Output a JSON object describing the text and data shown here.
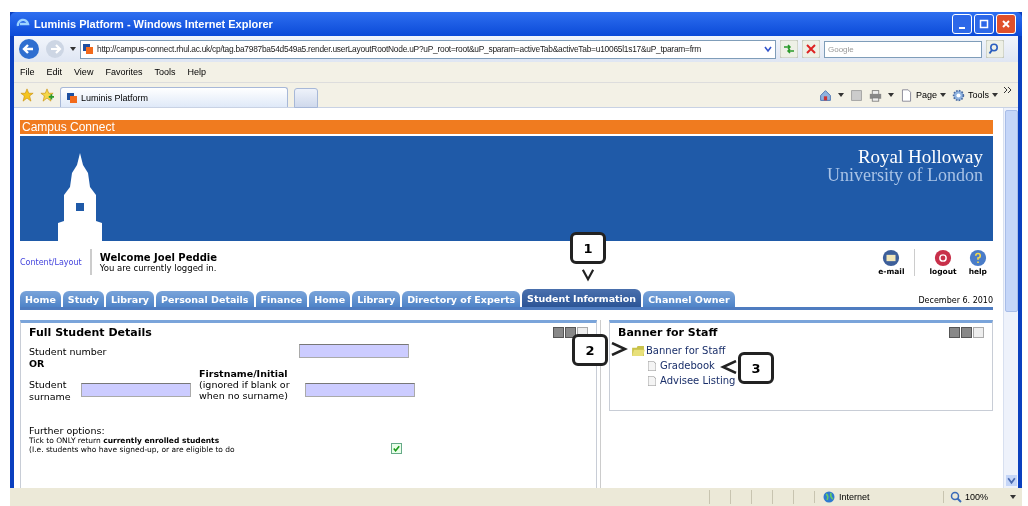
{
  "window": {
    "title": "Luminis Platform - Windows Internet Explorer"
  },
  "address_bar": {
    "url": "http://campus-connect.rhul.ac.uk/cp/tag.ba7987ba54d549a5.render.userLayoutRootNode.uP?uP_root=root&uP_sparam=activeTab&activeTab=u10065l1s17&uP_tparam=frm"
  },
  "search": {
    "placeholder": "Google"
  },
  "menu": [
    "File",
    "Edit",
    "View",
    "Favorites",
    "Tools",
    "Help"
  ],
  "browser_tab": {
    "title": "Luminis Platform"
  },
  "command_bar": [
    "Page",
    "Tools"
  ],
  "page": {
    "header": "Campus Connect",
    "institution": [
      "Royal Holloway",
      "University of London"
    ],
    "content_layout_link": "Content/Layout",
    "welcome": "Welcome Joel Peddie",
    "login_status": "You are currently logged in.",
    "actions": [
      {
        "kind": "email",
        "label": "e-mail"
      },
      {
        "kind": "logout",
        "label": "logout"
      },
      {
        "kind": "help",
        "label": "help"
      }
    ],
    "tabs": [
      {
        "label": "Home",
        "selected": false
      },
      {
        "label": "Study",
        "selected": false
      },
      {
        "label": "Library",
        "selected": false
      },
      {
        "label": "Personal Details",
        "selected": false
      },
      {
        "label": "Finance",
        "selected": false
      },
      {
        "label": "Home",
        "selected": false
      },
      {
        "label": "Library",
        "selected": false
      },
      {
        "label": "Directory of Experts",
        "selected": false
      },
      {
        "label": "Student Information",
        "selected": true
      },
      {
        "label": "Channel Owner",
        "selected": false
      }
    ],
    "date": "December 6. 2010"
  },
  "student_panel": {
    "title": "Full Student Details",
    "student_number_label": "Student number",
    "or_label": "OR",
    "surname_label": "Student surname",
    "firstname_label": "Firstname/Initial",
    "firstname_hint": "(ignored if blank or when no surname)",
    "further_options": "Further options:",
    "tick_text": "Tick to ONLY return **currently enrolled students**",
    "tick_note": "(I.e. students who have signed-up, or are eligible to do",
    "enrolled_only": {
      "checked": true
    }
  },
  "banner_panel": {
    "title": "Banner for Staff",
    "folder": {
      "label": "Banner for Staff",
      "expanded": true,
      "children": [
        {
          "label": "Gradebook"
        },
        {
          "label": "Advisee Listing"
        }
      ]
    }
  },
  "callouts": [
    "1",
    "2",
    "3"
  ],
  "status_bar": {
    "zone": "Internet",
    "zoom": "100%"
  }
}
